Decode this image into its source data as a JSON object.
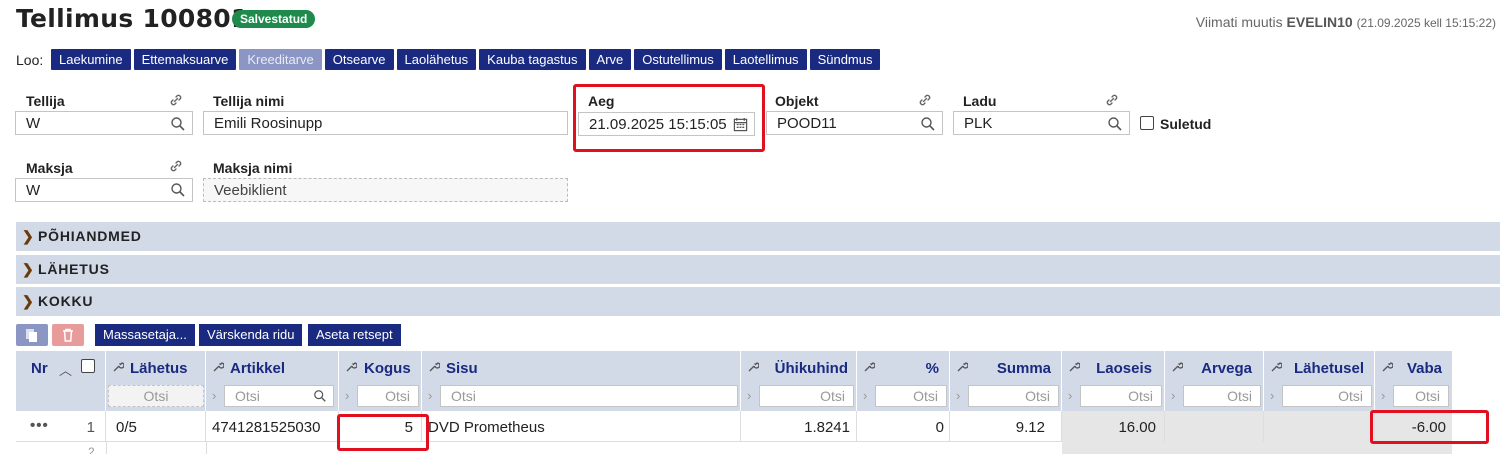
{
  "header": {
    "title": "Tellimus 100801",
    "status_badge": "Salvestatud",
    "modified_label": "Viimati muutis",
    "modified_user": "EVELIN10",
    "modified_time": "(21.09.2025 kell 15:15:22)"
  },
  "create_bar": {
    "label": "Loo:",
    "buttons": [
      "Laekumine",
      "Ettemaksuarve",
      "Kreeditarve",
      "Otsearve",
      "Laolähetus",
      "Kauba tagastus",
      "Arve",
      "Ostutellimus",
      "Laotellimus",
      "Sündmus"
    ],
    "disabled": [
      "Kreeditarve"
    ]
  },
  "fields": {
    "tellija": {
      "label": "Tellija",
      "value": "W"
    },
    "tellija_nimi": {
      "label": "Tellija nimi",
      "value": "Emili Roosinupp"
    },
    "aeg": {
      "label": "Aeg",
      "value": "21.09.2025 15:15:05"
    },
    "objekt": {
      "label": "Objekt",
      "value": "POOD11"
    },
    "ladu": {
      "label": "Ladu",
      "value": "PLK"
    },
    "suletud": {
      "label": "Suletud",
      "checked": false
    },
    "maksja": {
      "label": "Maksja",
      "value": "W"
    },
    "maksja_nimi": {
      "label": "Maksja nimi",
      "value": "Veebiklient"
    }
  },
  "sections": [
    "PÕHIANDMED",
    "LÄHETUS",
    "KOKKU"
  ],
  "row_toolbar": {
    "buttons": [
      "Massasetaja...",
      "Värskenda ridu",
      "Aseta retsept"
    ]
  },
  "table": {
    "columns": [
      "Nr",
      "Lähetus",
      "Artikkel",
      "Kogus",
      "Sisu",
      "Ühikuhind",
      "%",
      "Summa",
      "Laoseis",
      "Arvega",
      "Lähetusel",
      "Vaba"
    ],
    "search_placeholder": "Otsi",
    "row": {
      "menu": "•••",
      "nr": "1",
      "lahetus": "0/5",
      "artikkel": "4741281525030",
      "kogus": "5",
      "sisu": "DVD Prometheus",
      "uhikuhind": "1.8241",
      "protsent": "0",
      "summa": "9.12",
      "laoseis": "16.00",
      "arvega": "",
      "lahetusel": "",
      "vaba": "-6.00"
    },
    "row2_nr": "2"
  },
  "colors": {
    "primary_button": "#1a2a80",
    "badge": "#1e8a4c",
    "highlight_box": "#e01020",
    "section_bar": "#d2d9e7"
  }
}
